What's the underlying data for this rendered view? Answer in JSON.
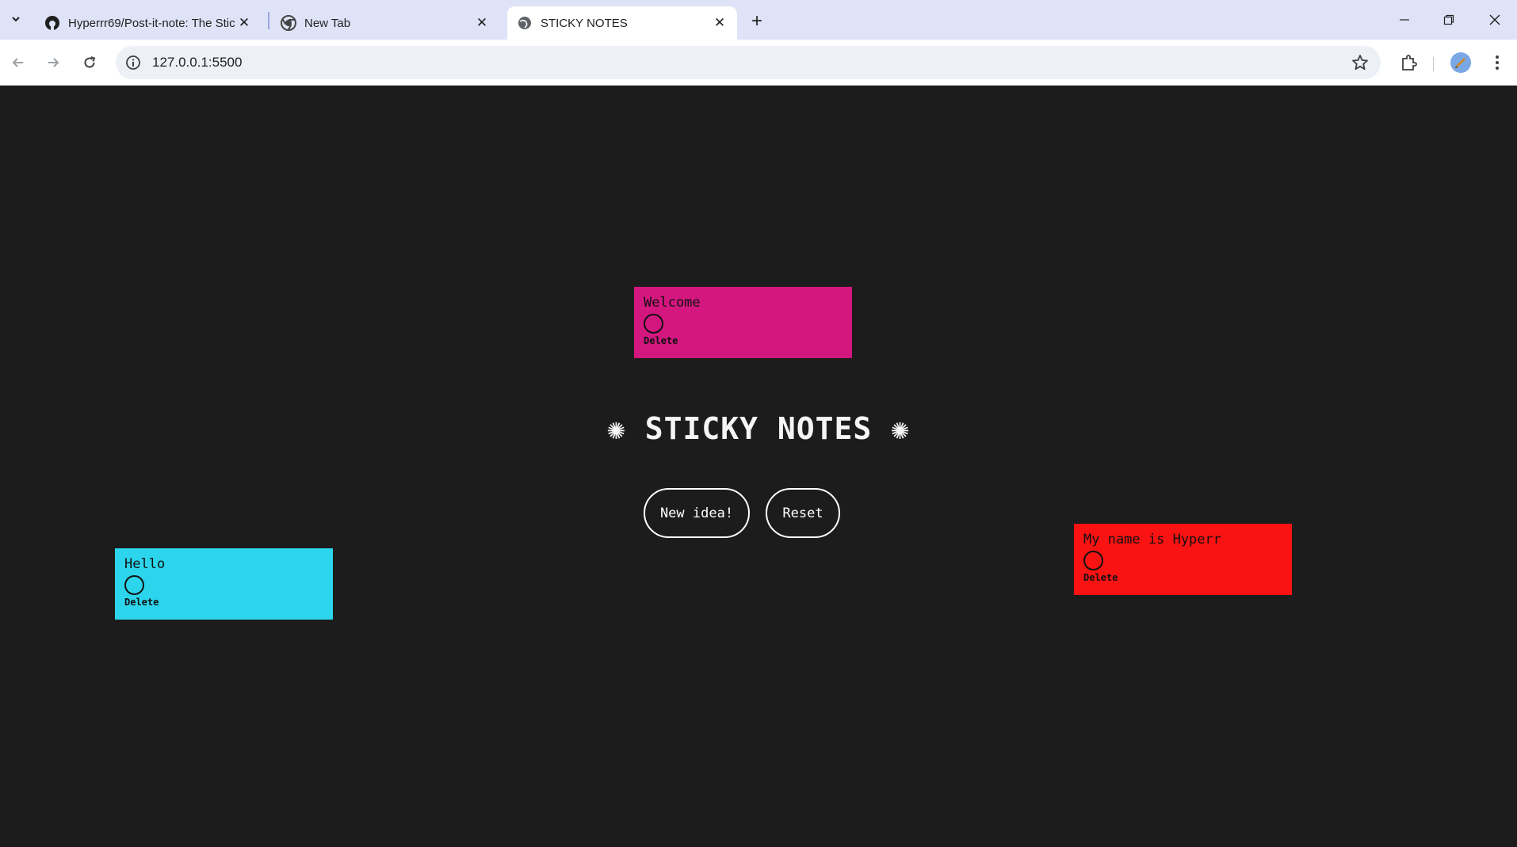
{
  "browser": {
    "tabs": [
      {
        "title": "Hyperrr69/Post-it-note: The Stic",
        "favicon": "github-icon",
        "active": false
      },
      {
        "title": "New Tab",
        "favicon": "chrome-icon",
        "active": false
      },
      {
        "title": "STICKY NOTES",
        "favicon": "globe-icon",
        "active": true
      }
    ],
    "url": "127.0.0.1:5500"
  },
  "app": {
    "title": "✺ STICKY NOTES ✺",
    "buttons": {
      "new_idea": "New idea!",
      "reset": "Reset"
    },
    "notes": [
      {
        "text": "Welcome",
        "delete_label": "Delete",
        "color": "#d4177f"
      },
      {
        "text": "Hello",
        "delete_label": "Delete",
        "color": "#2cd5eb"
      },
      {
        "text": "My name is Hyperr",
        "delete_label": "Delete",
        "color": "#fb1212"
      }
    ]
  },
  "colors": {
    "background": "#1c1c1c",
    "text": "#ffffff"
  }
}
